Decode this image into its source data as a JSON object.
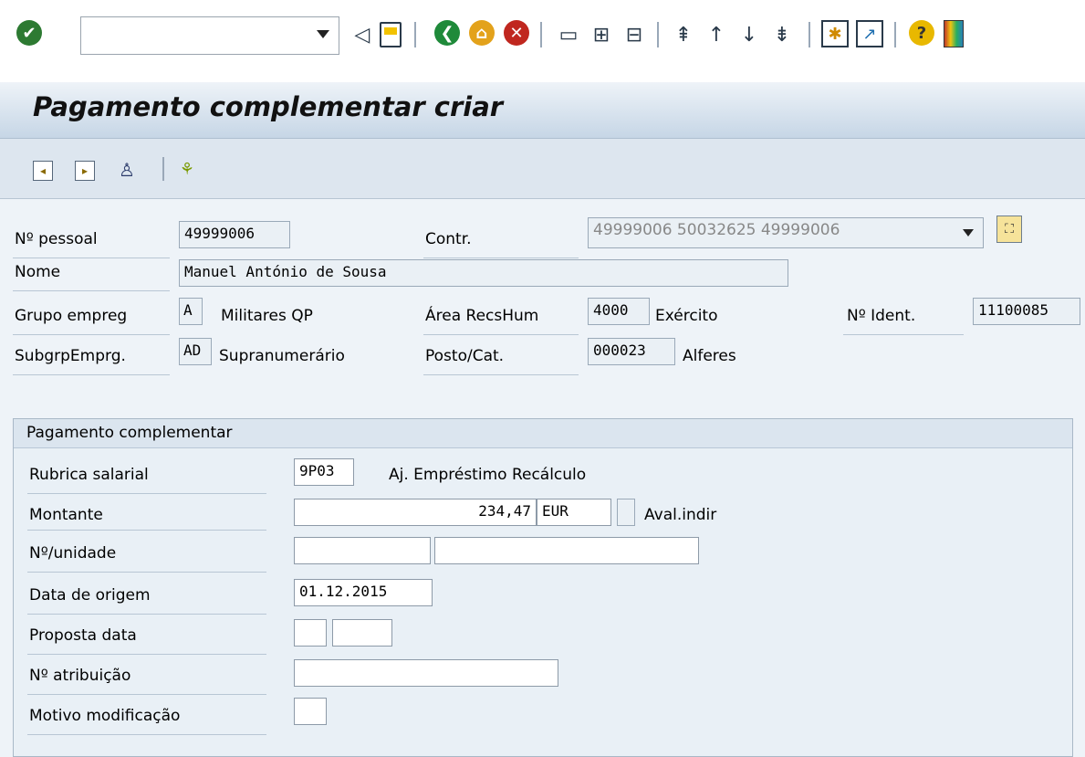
{
  "toolbar": {
    "command_value": "",
    "icons": [
      "enter-icon",
      "back-icon",
      "save-icon",
      "back-nav-icon",
      "exit-icon",
      "cancel-icon",
      "print-icon",
      "find-icon",
      "find-next-icon",
      "first-page-icon",
      "previous-page-icon",
      "next-page-icon",
      "last-page-icon",
      "new-session-icon",
      "shortcut-icon",
      "help-icon",
      "layout-icon"
    ]
  },
  "title": "Pagamento complementar criar",
  "app_toolbar": {
    "icons": [
      "previous-record-icon",
      "next-record-icon",
      "person-search-icon",
      "hierarchy-icon"
    ]
  },
  "header": {
    "personnel_label": "Nº pessoal",
    "personnel_value": "49999006",
    "contract_label": "Contr.",
    "contract_value": "49999006 50032625 49999006",
    "name_label": "Nome",
    "name_value": "Manuel António de Sousa",
    "emp_group_label": "Grupo empreg",
    "emp_group_value": "A",
    "emp_group_text": "Militares QP",
    "hr_area_label": "Área RecsHum",
    "hr_area_value": "4000",
    "hr_area_text": "Exército",
    "ident_label": "Nº Ident.",
    "ident_value": "11100085",
    "emp_subgroup_label": "SubgrpEmprg.",
    "emp_subgroup_value": "AD",
    "emp_subgroup_text": "Supranumerário",
    "rank_label": "Posto/Cat.",
    "rank_value": "000023",
    "rank_text": "Alferes"
  },
  "payment": {
    "group_title": "Pagamento complementar",
    "wage_type_label": "Rubrica salarial",
    "wage_type_value": "9P03",
    "wage_type_text": "Aj. Empréstimo Recálculo",
    "amount_label": "Montante",
    "amount_value": "234,47",
    "currency_value": "EUR",
    "indirect_value": "",
    "indirect_label": "Aval.indir",
    "number_unit_label": "Nº/unidade",
    "number_value": "",
    "unit_value": "",
    "origin_date_label": "Data de origem",
    "origin_date_value": "01.12.2015",
    "default_date_label": "Proposta data",
    "default_date_a": "",
    "default_date_b": "",
    "assignment_label": "Nº atribuição",
    "assignment_value": "",
    "reason_label": "Motivo modificação",
    "reason_value": ""
  },
  "colors": {
    "title_bg_top": "#eef3f8",
    "title_bg_bottom": "#c6d6e6",
    "enter_green": "#2d7a32",
    "nav_green": "#1f8a3a",
    "exit_yellow": "#e3a21b",
    "cancel_red": "#c0271f"
  }
}
